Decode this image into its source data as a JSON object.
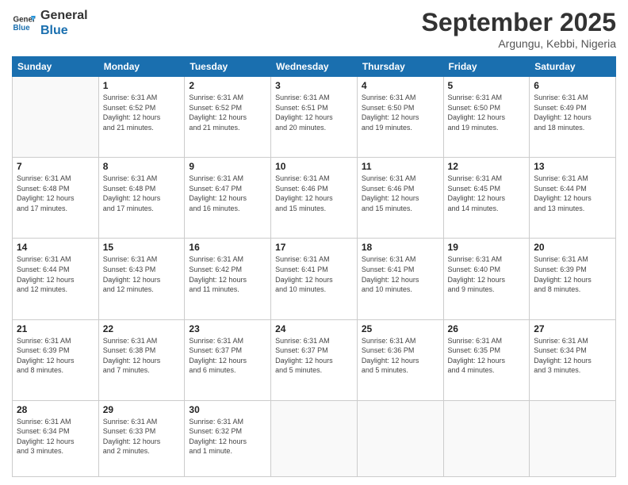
{
  "logo": {
    "line1": "General",
    "line2": "Blue"
  },
  "header": {
    "title": "September 2025",
    "location": "Argungu, Kebbi, Nigeria"
  },
  "weekdays": [
    "Sunday",
    "Monday",
    "Tuesday",
    "Wednesday",
    "Thursday",
    "Friday",
    "Saturday"
  ],
  "weeks": [
    [
      {
        "day": "",
        "info": ""
      },
      {
        "day": "1",
        "info": "Sunrise: 6:31 AM\nSunset: 6:52 PM\nDaylight: 12 hours\nand 21 minutes."
      },
      {
        "day": "2",
        "info": "Sunrise: 6:31 AM\nSunset: 6:52 PM\nDaylight: 12 hours\nand 21 minutes."
      },
      {
        "day": "3",
        "info": "Sunrise: 6:31 AM\nSunset: 6:51 PM\nDaylight: 12 hours\nand 20 minutes."
      },
      {
        "day": "4",
        "info": "Sunrise: 6:31 AM\nSunset: 6:50 PM\nDaylight: 12 hours\nand 19 minutes."
      },
      {
        "day": "5",
        "info": "Sunrise: 6:31 AM\nSunset: 6:50 PM\nDaylight: 12 hours\nand 19 minutes."
      },
      {
        "day": "6",
        "info": "Sunrise: 6:31 AM\nSunset: 6:49 PM\nDaylight: 12 hours\nand 18 minutes."
      }
    ],
    [
      {
        "day": "7",
        "info": "Sunrise: 6:31 AM\nSunset: 6:48 PM\nDaylight: 12 hours\nand 17 minutes."
      },
      {
        "day": "8",
        "info": "Sunrise: 6:31 AM\nSunset: 6:48 PM\nDaylight: 12 hours\nand 17 minutes."
      },
      {
        "day": "9",
        "info": "Sunrise: 6:31 AM\nSunset: 6:47 PM\nDaylight: 12 hours\nand 16 minutes."
      },
      {
        "day": "10",
        "info": "Sunrise: 6:31 AM\nSunset: 6:46 PM\nDaylight: 12 hours\nand 15 minutes."
      },
      {
        "day": "11",
        "info": "Sunrise: 6:31 AM\nSunset: 6:46 PM\nDaylight: 12 hours\nand 15 minutes."
      },
      {
        "day": "12",
        "info": "Sunrise: 6:31 AM\nSunset: 6:45 PM\nDaylight: 12 hours\nand 14 minutes."
      },
      {
        "day": "13",
        "info": "Sunrise: 6:31 AM\nSunset: 6:44 PM\nDaylight: 12 hours\nand 13 minutes."
      }
    ],
    [
      {
        "day": "14",
        "info": "Sunrise: 6:31 AM\nSunset: 6:44 PM\nDaylight: 12 hours\nand 12 minutes."
      },
      {
        "day": "15",
        "info": "Sunrise: 6:31 AM\nSunset: 6:43 PM\nDaylight: 12 hours\nand 12 minutes."
      },
      {
        "day": "16",
        "info": "Sunrise: 6:31 AM\nSunset: 6:42 PM\nDaylight: 12 hours\nand 11 minutes."
      },
      {
        "day": "17",
        "info": "Sunrise: 6:31 AM\nSunset: 6:41 PM\nDaylight: 12 hours\nand 10 minutes."
      },
      {
        "day": "18",
        "info": "Sunrise: 6:31 AM\nSunset: 6:41 PM\nDaylight: 12 hours\nand 10 minutes."
      },
      {
        "day": "19",
        "info": "Sunrise: 6:31 AM\nSunset: 6:40 PM\nDaylight: 12 hours\nand 9 minutes."
      },
      {
        "day": "20",
        "info": "Sunrise: 6:31 AM\nSunset: 6:39 PM\nDaylight: 12 hours\nand 8 minutes."
      }
    ],
    [
      {
        "day": "21",
        "info": "Sunrise: 6:31 AM\nSunset: 6:39 PM\nDaylight: 12 hours\nand 8 minutes."
      },
      {
        "day": "22",
        "info": "Sunrise: 6:31 AM\nSunset: 6:38 PM\nDaylight: 12 hours\nand 7 minutes."
      },
      {
        "day": "23",
        "info": "Sunrise: 6:31 AM\nSunset: 6:37 PM\nDaylight: 12 hours\nand 6 minutes."
      },
      {
        "day": "24",
        "info": "Sunrise: 6:31 AM\nSunset: 6:37 PM\nDaylight: 12 hours\nand 5 minutes."
      },
      {
        "day": "25",
        "info": "Sunrise: 6:31 AM\nSunset: 6:36 PM\nDaylight: 12 hours\nand 5 minutes."
      },
      {
        "day": "26",
        "info": "Sunrise: 6:31 AM\nSunset: 6:35 PM\nDaylight: 12 hours\nand 4 minutes."
      },
      {
        "day": "27",
        "info": "Sunrise: 6:31 AM\nSunset: 6:34 PM\nDaylight: 12 hours\nand 3 minutes."
      }
    ],
    [
      {
        "day": "28",
        "info": "Sunrise: 6:31 AM\nSunset: 6:34 PM\nDaylight: 12 hours\nand 3 minutes."
      },
      {
        "day": "29",
        "info": "Sunrise: 6:31 AM\nSunset: 6:33 PM\nDaylight: 12 hours\nand 2 minutes."
      },
      {
        "day": "30",
        "info": "Sunrise: 6:31 AM\nSunset: 6:32 PM\nDaylight: 12 hours\nand 1 minute."
      },
      {
        "day": "",
        "info": ""
      },
      {
        "day": "",
        "info": ""
      },
      {
        "day": "",
        "info": ""
      },
      {
        "day": "",
        "info": ""
      }
    ]
  ]
}
